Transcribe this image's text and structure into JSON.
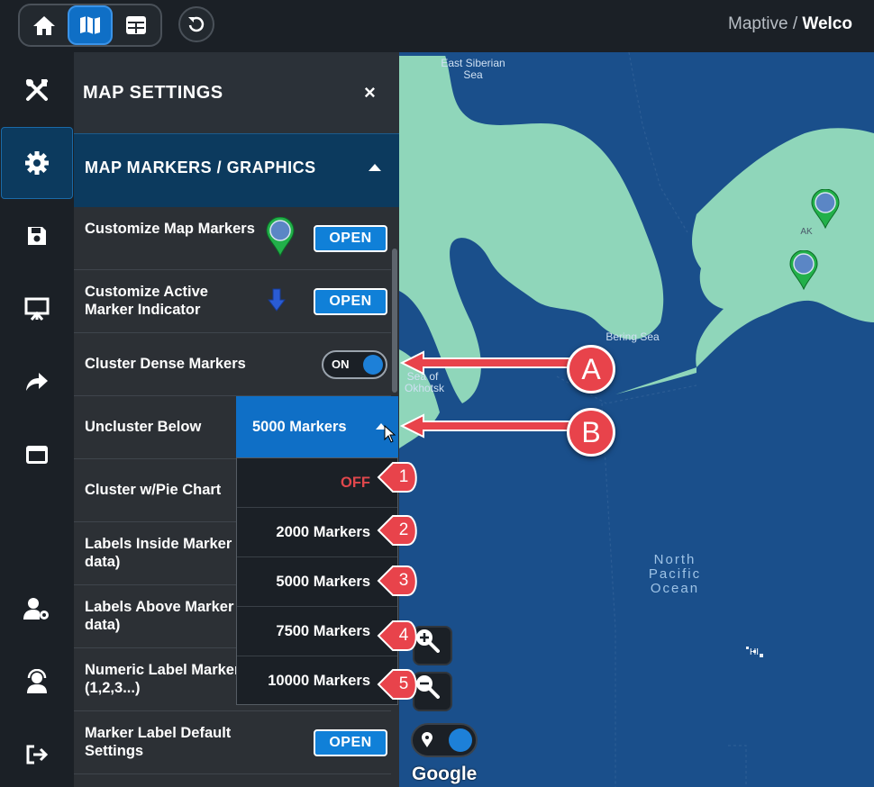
{
  "breadcrumb": {
    "app": "Maptive",
    "separator": "/",
    "page": "Welco"
  },
  "topbar": {
    "buttons": [
      {
        "icon": "home-icon"
      },
      {
        "icon": "map-icon",
        "active": true
      },
      {
        "icon": "table-icon"
      }
    ],
    "undo_icon": "undo-icon"
  },
  "rail": {
    "items": [
      {
        "icon": "tools-icon"
      },
      {
        "icon": "gear-icon",
        "active": true
      },
      {
        "icon": "save-icon"
      },
      {
        "icon": "presentation-icon"
      },
      {
        "icon": "share-icon"
      },
      {
        "icon": "window-icon"
      },
      {
        "icon": "user-settings-icon"
      },
      {
        "icon": "support-icon"
      },
      {
        "icon": "logout-icon"
      }
    ]
  },
  "panel": {
    "title": "MAP SETTINGS",
    "close": "×",
    "section": "MAP MARKERS / GRAPHICS",
    "rows": [
      {
        "label": "Customize Map Markers",
        "button": "OPEN"
      },
      {
        "label": "Customize Active Marker Indicator",
        "button": "OPEN"
      },
      {
        "label": "Cluster Dense Markers",
        "toggle": "ON"
      },
      {
        "label": "Uncluster Below"
      },
      {
        "label": "Cluster w/Pie Chart"
      },
      {
        "label": "Labels Inside Marker data)"
      },
      {
        "label": "Labels Above Marker data)"
      },
      {
        "label": "Numeric Label Marker (1,2,3...)"
      },
      {
        "label": "Marker Label Default Settings",
        "button": "OPEN"
      }
    ]
  },
  "select": {
    "value": "5000 Markers",
    "options": [
      "OFF",
      "2000 Markers",
      "5000 Markers",
      "7500 Markers",
      "10000 Markers"
    ]
  },
  "map": {
    "labels": {
      "east_siberian": "East Siberian Sea",
      "bering": "Bering Sea",
      "okhotsk": "Sea of Okhotsk",
      "ocean": "North Pacific Ocean",
      "ak": "AK",
      "hi": "HI"
    },
    "google": "Google"
  },
  "annotations": {
    "letters": [
      "A",
      "B"
    ],
    "numbers": [
      "1",
      "2",
      "3",
      "4",
      "5"
    ],
    "color": "#e8434b"
  }
}
